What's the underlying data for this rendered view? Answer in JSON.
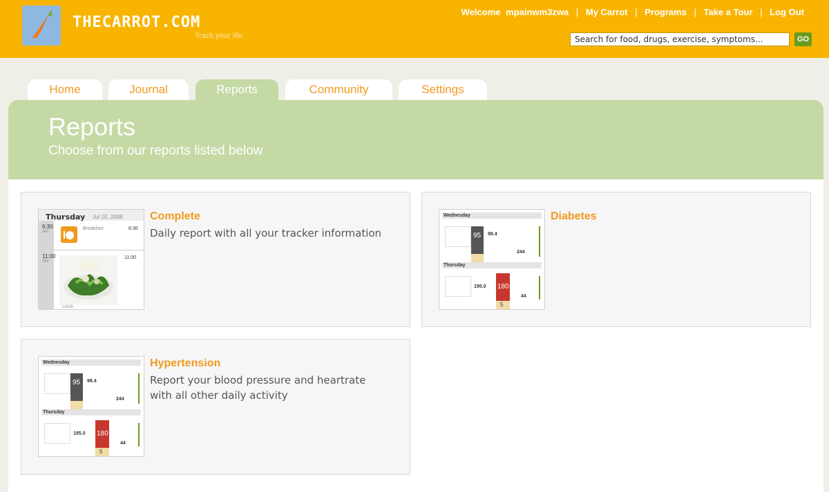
{
  "brand": {
    "name": "THECARROT.COM",
    "tagline": "Track your life."
  },
  "topnav": {
    "welcome": "Welcome",
    "username": "mpainwm3zwa",
    "links": [
      "My Carrot",
      "Programs",
      "Take a Tour",
      "Log Out"
    ]
  },
  "search": {
    "placeholder": "Search for food, drugs, exercise, symptoms...",
    "go_label": "GO"
  },
  "tabs": [
    {
      "label": "Home",
      "active": false
    },
    {
      "label": "Journal",
      "active": false
    },
    {
      "label": "Reports",
      "active": true
    },
    {
      "label": "Community",
      "active": false
    },
    {
      "label": "Settings",
      "active": false
    }
  ],
  "banner": {
    "title": "Reports",
    "subtitle": "Choose from our reports listed below"
  },
  "reports": [
    {
      "title": "Complete",
      "description": "Daily report with all your tracker information"
    },
    {
      "title": "Diabetes",
      "description": ""
    },
    {
      "title": "Hypertension",
      "description": "Report your blood pressure and heartrate with all other daily activity"
    }
  ],
  "thumb_complete": {
    "day": "Thursday",
    "date": "Jul 10, 2008",
    "time1": "6:30",
    "ampm1": "AM",
    "label1": "Breakfast",
    "time2": "11:00",
    "ampm2": "AM",
    "label2": "Lunch"
  },
  "thumb_mini": {
    "day1": "Wednesday",
    "day2": "Thursday",
    "v1": "95",
    "v2": "98.4",
    "v3": "180",
    "v4": "195.0",
    "v5": "244",
    "v6": "5",
    "v7": "44"
  },
  "colors": {
    "header": "#f8b400",
    "accent": "#f19a1f",
    "banner": "#c5d9a4",
    "go": "#6a9a1f"
  }
}
